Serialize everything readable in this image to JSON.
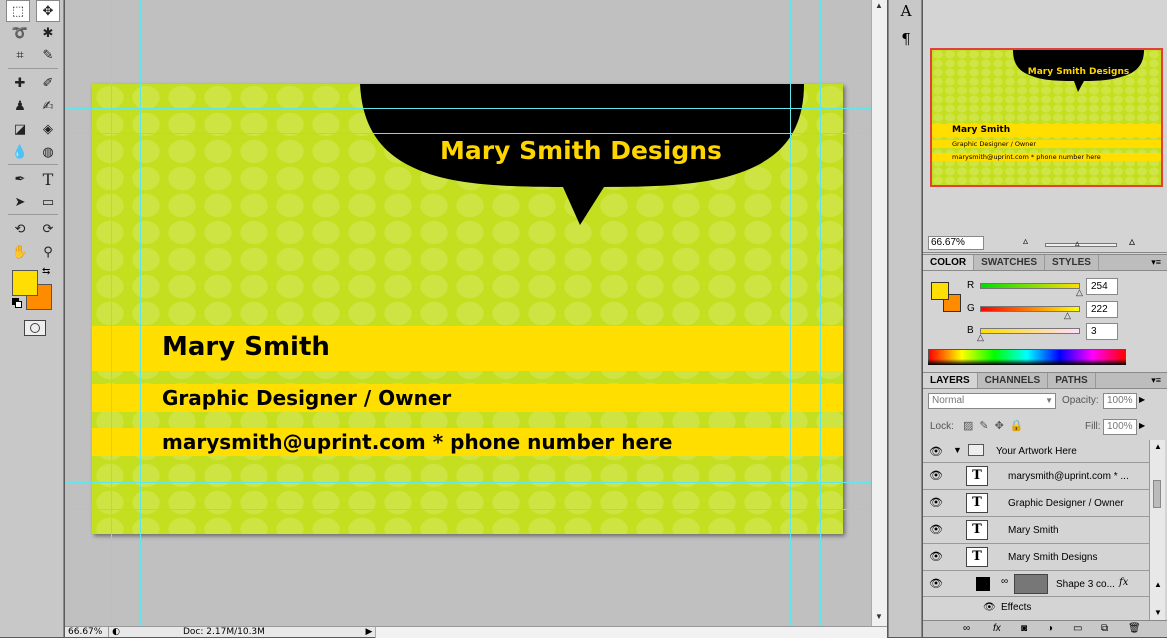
{
  "colors": {
    "fg": "#fede03",
    "bg": "#ff8c00",
    "card_green": "#c4df1f",
    "band_yellow": "#ffde00",
    "title_yellow": "#ffd500",
    "guide": "#5fe6ec"
  },
  "tools": {
    "icons": [
      "marquee-icon",
      "move-icon",
      "lasso-icon",
      "magic-wand-icon",
      "crop-icon",
      "eyedropper-icon",
      "healing-brush-icon",
      "brush-icon",
      "clone-stamp-icon",
      "history-brush-icon",
      "eraser-icon",
      "paint-bucket-icon",
      "blur-icon",
      "dodge-icon",
      "pen-icon",
      "type-icon",
      "path-select-icon",
      "rectangle-icon",
      "3d-rotate-icon",
      "3d-orbit-icon",
      "hand-icon",
      "zoom-icon"
    ]
  },
  "card": {
    "bubble_title": "Mary Smith Designs",
    "name": "Mary Smith",
    "role": "Graphic Designer / Owner",
    "contact": "marysmith@uprint.com * phone number here"
  },
  "status": {
    "zoom": "66.67%",
    "doc": "Doc: 2.17M/10.3M"
  },
  "navigator": {
    "zoom": "66.67%"
  },
  "color_panel": {
    "tabs": [
      "COLOR",
      "SWATCHES",
      "STYLES"
    ],
    "channels": [
      {
        "label": "R",
        "value": "254"
      },
      {
        "label": "G",
        "value": "222"
      },
      {
        "label": "B",
        "value": "3"
      }
    ]
  },
  "layers_panel": {
    "tabs": [
      "LAYERS",
      "CHANNELS",
      "PATHS"
    ],
    "blend_mode": "Normal",
    "opacity_label": "Opacity:",
    "opacity": "100%",
    "lock_label": "Lock:",
    "fill_label": "Fill:",
    "fill": "100%",
    "group_name": "Your Artwork Here",
    "text_layers": [
      "marysmith@uprint.com * ...",
      "Graphic Designer / Owner",
      "Mary Smith",
      "Mary Smith Designs"
    ],
    "shape_layer": "Shape 3 co...",
    "fx_label": "fx",
    "effects_label": "Effects"
  },
  "midstrip": {
    "char_icon": "A",
    "para_icon": "¶"
  }
}
